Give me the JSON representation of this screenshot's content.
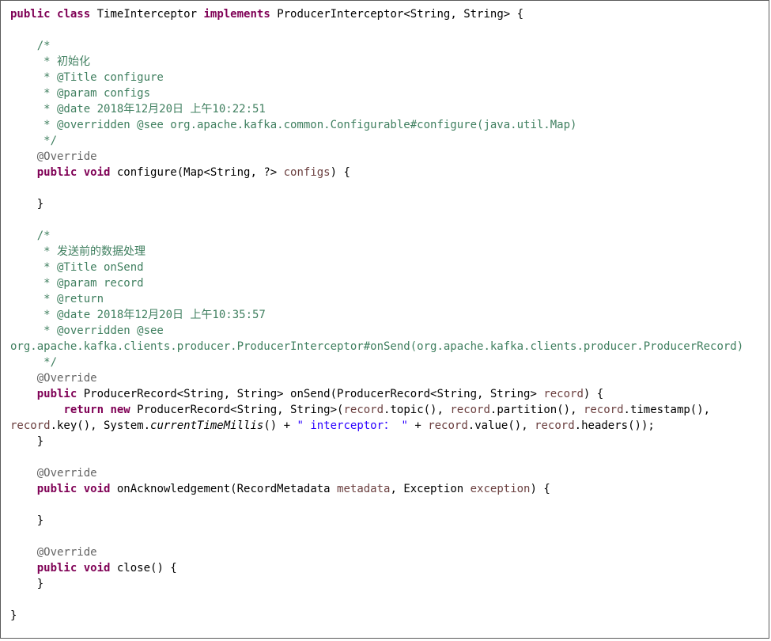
{
  "editor": {
    "lines": [
      [
        {
          "t": "public",
          "c": "kw"
        },
        {
          "t": " "
        },
        {
          "t": "class",
          "c": "kw"
        },
        {
          "t": " TimeInterceptor "
        },
        {
          "t": "implements",
          "c": "kw"
        },
        {
          "t": " ProducerInterceptor<String, String> {"
        }
      ],
      [],
      [
        {
          "t": "    "
        },
        {
          "t": "/*",
          "c": "cm"
        }
      ],
      [
        {
          "t": "     * 初始化",
          "c": "cm"
        }
      ],
      [
        {
          "t": "     * @Title configure",
          "c": "cm"
        }
      ],
      [
        {
          "t": "     * @param configs",
          "c": "cm"
        }
      ],
      [
        {
          "t": "     * @date 2018年12月20日 上午10:22:51",
          "c": "cm"
        }
      ],
      [
        {
          "t": "     * @overridden @see org.apache.kafka.common.Configurable#configure(java.util.Map)",
          "c": "cm"
        }
      ],
      [
        {
          "t": "     */",
          "c": "cm"
        }
      ],
      [
        {
          "t": "    "
        },
        {
          "t": "@Override",
          "c": "an"
        }
      ],
      [
        {
          "t": "    "
        },
        {
          "t": "public",
          "c": "kw"
        },
        {
          "t": " "
        },
        {
          "t": "void",
          "c": "kw"
        },
        {
          "t": " configure(Map<String, ?> "
        },
        {
          "t": "configs",
          "c": "pr"
        },
        {
          "t": ") {"
        }
      ],
      [],
      [
        {
          "t": "    }"
        }
      ],
      [],
      [
        {
          "t": "    "
        },
        {
          "t": "/*",
          "c": "cm"
        }
      ],
      [
        {
          "t": "     * 发送前的数据处理",
          "c": "cm"
        }
      ],
      [
        {
          "t": "     * @Title onSend",
          "c": "cm"
        }
      ],
      [
        {
          "t": "     * @param record",
          "c": "cm"
        }
      ],
      [
        {
          "t": "     * @return",
          "c": "cm"
        }
      ],
      [
        {
          "t": "     * @date 2018年12月20日 上午10:35:57",
          "c": "cm"
        }
      ],
      [
        {
          "t": "     * @overridden @see",
          "c": "cm"
        }
      ],
      [
        {
          "t": "org.apache.kafka.clients.producer.ProducerInterceptor#onSend(org.apache.kafka.clients.producer.ProducerRecord)",
          "c": "cm"
        }
      ],
      [
        {
          "t": "     */",
          "c": "cm"
        }
      ],
      [
        {
          "t": "    "
        },
        {
          "t": "@Override",
          "c": "an"
        }
      ],
      [
        {
          "t": "    "
        },
        {
          "t": "public",
          "c": "kw"
        },
        {
          "t": " ProducerRecord<String, String> onSend(ProducerRecord<String, String> "
        },
        {
          "t": "record",
          "c": "pr"
        },
        {
          "t": ") {"
        }
      ],
      [
        {
          "t": "        "
        },
        {
          "t": "return",
          "c": "kw"
        },
        {
          "t": " "
        },
        {
          "t": "new",
          "c": "kw"
        },
        {
          "t": " ProducerRecord<String, String>("
        },
        {
          "t": "record",
          "c": "pr"
        },
        {
          "t": ".topic(), "
        },
        {
          "t": "record",
          "c": "pr"
        },
        {
          "t": ".partition(), "
        },
        {
          "t": "record",
          "c": "pr"
        },
        {
          "t": ".timestamp(),"
        }
      ],
      [
        {
          "t": "record",
          "c": "pr"
        },
        {
          "t": ".key(), System."
        },
        {
          "t": "currentTimeMillis",
          "c": "it"
        },
        {
          "t": "() + "
        },
        {
          "t": "\" interceptor： \"",
          "c": "st"
        },
        {
          "t": " + "
        },
        {
          "t": "record",
          "c": "pr"
        },
        {
          "t": ".value(), "
        },
        {
          "t": "record",
          "c": "pr"
        },
        {
          "t": ".headers());"
        }
      ],
      [
        {
          "t": "    }"
        }
      ],
      [],
      [
        {
          "t": "    "
        },
        {
          "t": "@Override",
          "c": "an"
        }
      ],
      [
        {
          "t": "    "
        },
        {
          "t": "public",
          "c": "kw"
        },
        {
          "t": " "
        },
        {
          "t": "void",
          "c": "kw"
        },
        {
          "t": " onAcknowledgement(RecordMetadata "
        },
        {
          "t": "metadata",
          "c": "pr"
        },
        {
          "t": ", Exception "
        },
        {
          "t": "exception",
          "c": "pr"
        },
        {
          "t": ") {"
        }
      ],
      [],
      [
        {
          "t": "    }"
        }
      ],
      [],
      [
        {
          "t": "    "
        },
        {
          "t": "@Override",
          "c": "an"
        }
      ],
      [
        {
          "t": "    "
        },
        {
          "t": "public",
          "c": "kw"
        },
        {
          "t": " "
        },
        {
          "t": "void",
          "c": "kw"
        },
        {
          "t": " close() {"
        }
      ],
      [
        {
          "t": "    }"
        }
      ],
      [],
      [
        {
          "t": "}"
        }
      ]
    ]
  }
}
